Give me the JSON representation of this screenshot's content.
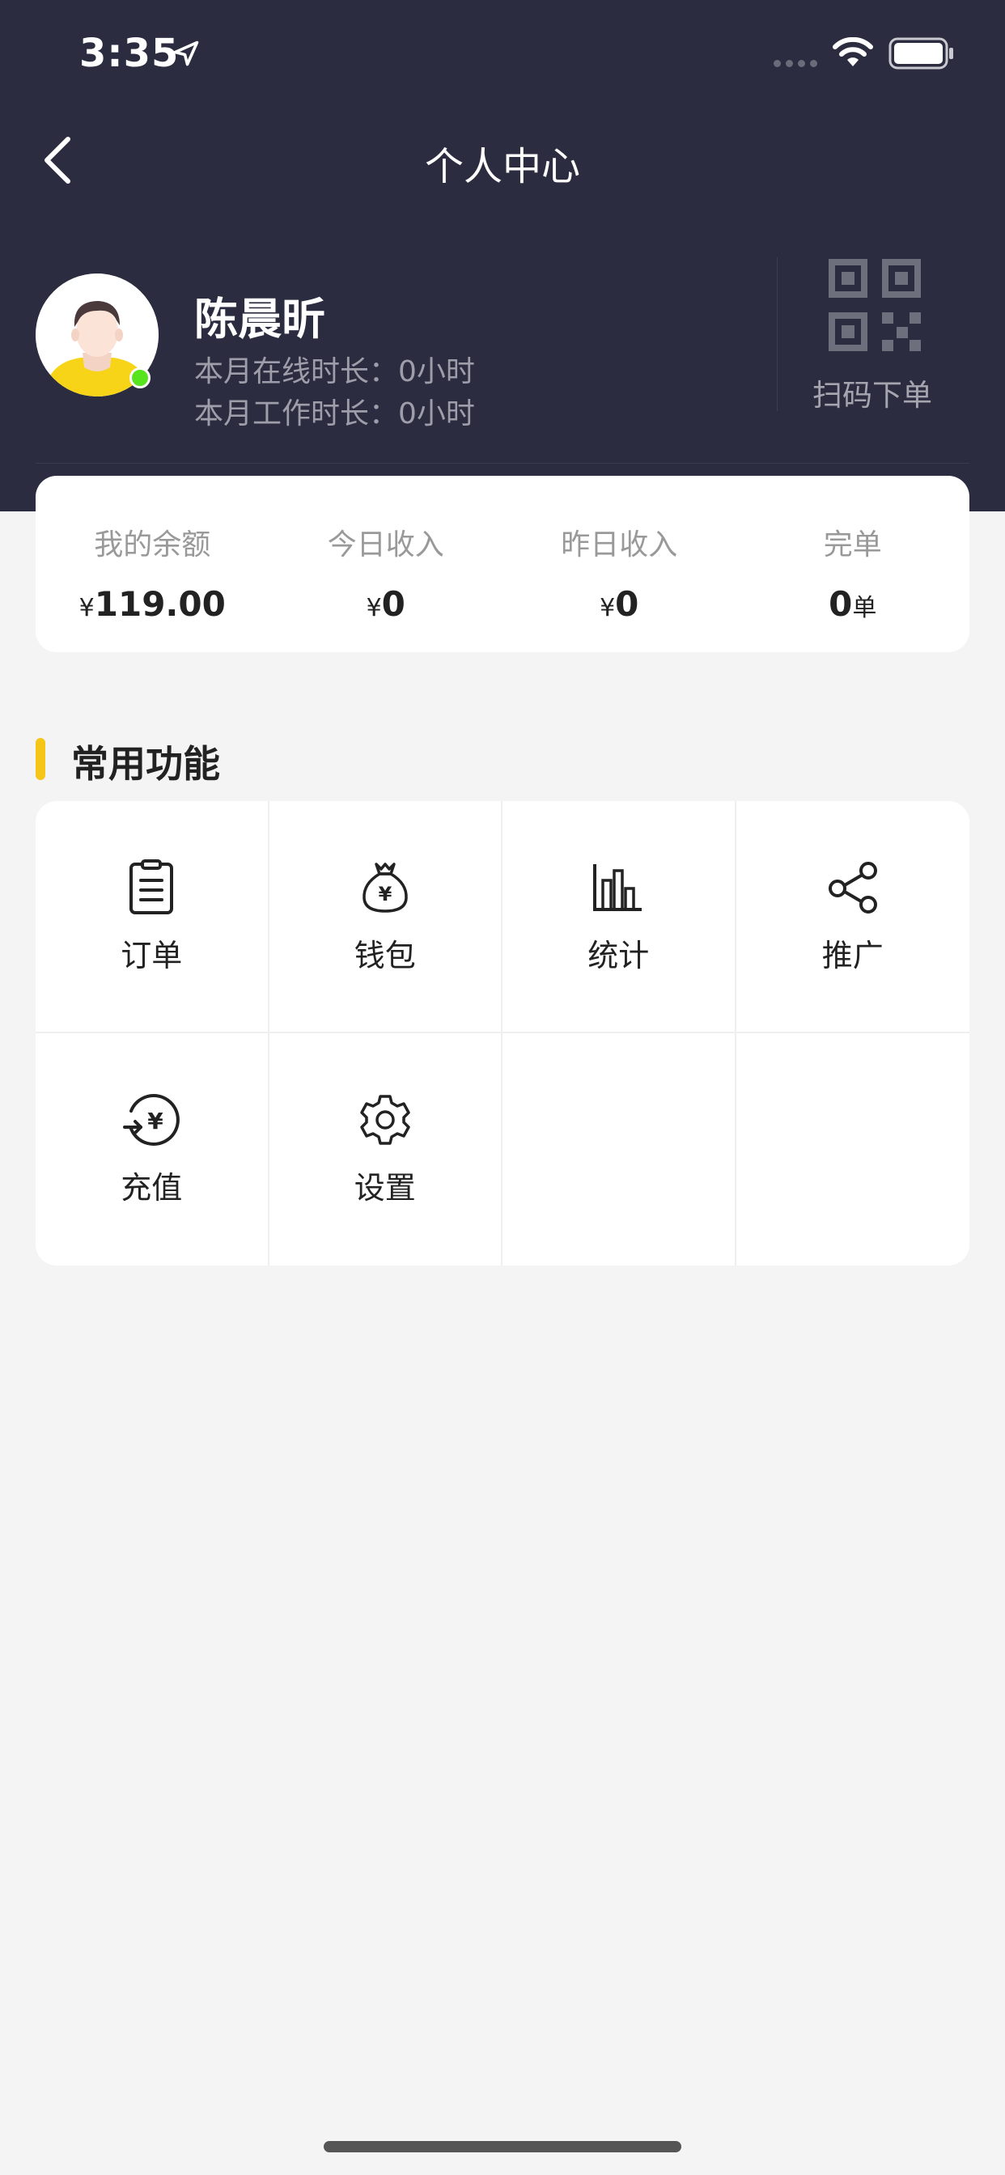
{
  "status_bar": {
    "time": "3:35"
  },
  "nav": {
    "title": "个人中心"
  },
  "profile": {
    "name": "陈晨昕",
    "online_time": "本月在线时长：0小时",
    "work_time": "本月工作时长：0小时",
    "qr_label": "扫码下单"
  },
  "stats": [
    {
      "label": "我的余额",
      "prefix": "¥",
      "value": "119.00",
      "suffix": ""
    },
    {
      "label": "今日收入",
      "prefix": "¥",
      "value": "0",
      "suffix": ""
    },
    {
      "label": "昨日收入",
      "prefix": "¥",
      "value": "0",
      "suffix": ""
    },
    {
      "label": "完单",
      "prefix": "",
      "value": "0",
      "suffix": "单"
    }
  ],
  "section": {
    "title": "常用功能"
  },
  "functions": [
    {
      "label": "订单",
      "icon": "clipboard-icon"
    },
    {
      "label": "钱包",
      "icon": "money-bag-icon"
    },
    {
      "label": "统计",
      "icon": "bar-chart-icon"
    },
    {
      "label": "推广",
      "icon": "share-icon"
    },
    {
      "label": "充值",
      "icon": "recharge-icon"
    },
    {
      "label": "设置",
      "icon": "gear-icon"
    }
  ],
  "colors": {
    "header": "#2b2c3f",
    "accent": "#f5c518",
    "online": "#57e31d",
    "background": "#f4f4f4"
  }
}
